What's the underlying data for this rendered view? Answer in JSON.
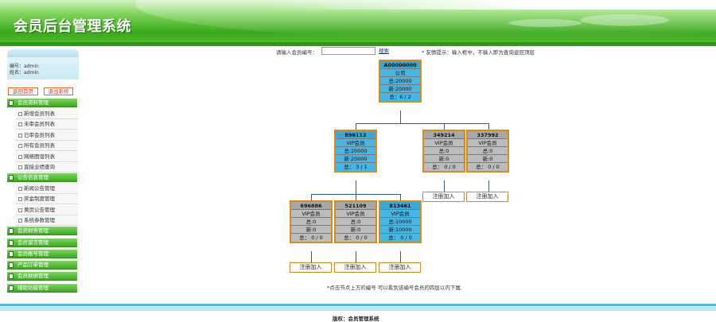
{
  "header": {
    "title": "会员后台管理系统"
  },
  "user": {
    "id_line": "编号：admin",
    "name_line": "姓名：admin"
  },
  "buttons": {
    "home": "返回首页",
    "logout": "退出系统"
  },
  "sidebar": {
    "sections": [
      {
        "label": "会员资料管理",
        "items": [
          "新增会员列表",
          "未审会员列表",
          "已审会员列表",
          "所有会员列表",
          "网络图谱列表",
          "直接业绩查询"
        ]
      },
      {
        "label": "公告信息管理",
        "items": [
          "新闻公告管理",
          "奖金制度管理",
          "黄页公告管理",
          "系统参数管理"
        ]
      },
      {
        "label": "会员财务管理",
        "items": []
      },
      {
        "label": "会员留言管理",
        "items": []
      },
      {
        "label": "会员帐号管理",
        "items": []
      },
      {
        "label": "产品订单管理",
        "items": []
      },
      {
        "label": "会员数据管理",
        "items": []
      },
      {
        "label": "辅助功能管理",
        "items": []
      }
    ]
  },
  "search": {
    "label": "请输入会员编号：",
    "value": "",
    "button": "搜索",
    "tip": "* 友情提示：输入框中，不输入即为查询返回顶层"
  },
  "tree": {
    "nodes": [
      {
        "code": "A00000000",
        "rows": [
          "公司",
          "总:20000",
          "新:20000",
          "总：6 / 2"
        ],
        "color": "blue"
      },
      {
        "code": "896112",
        "rows": [
          "VIP会员",
          "总:20000",
          "新:20000",
          "总： 3 / 1"
        ],
        "color": "blue"
      },
      {
        "code": "349214",
        "rows": [
          "VIP会员",
          "总:0",
          "新:0",
          "总： 0 / 0"
        ],
        "color": "gray"
      },
      {
        "code": "337992",
        "rows": [
          "VIP会员",
          "总:0",
          "新:0",
          "总： 0 / 0"
        ],
        "color": "gray"
      },
      {
        "code": "696886",
        "rows": [
          "VIP会员",
          "总:0",
          "新:0",
          "总： 0 / 0"
        ],
        "color": "gray"
      },
      {
        "code": "521109",
        "rows": [
          "VIP会员",
          "总:0",
          "新:0",
          "总： 0 / 0"
        ],
        "color": "gray"
      },
      {
        "code": "813461",
        "rows": [
          "VIP会员",
          "总:10000",
          "新:10000",
          "总： 0 / 0"
        ],
        "color": "blue"
      }
    ],
    "register_label": "注册加入"
  },
  "note": "*点击节点上方的编号 可以看到该编号会员的四层以内下属.",
  "footer": {
    "text": "版权：会员管理系统"
  },
  "colors": {
    "header_green": "#3aa81d",
    "node_blue": "#47b6e4",
    "node_gray": "#bcbcbc",
    "node_border": "#d58b22",
    "footer_blue": "#4fb9e0"
  }
}
